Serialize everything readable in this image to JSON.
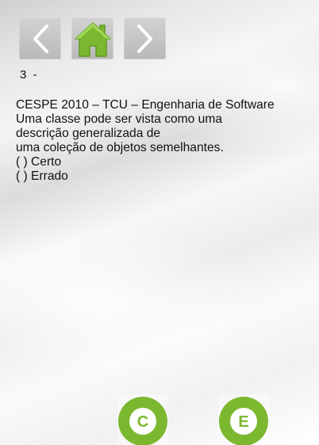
{
  "nav": {
    "previous_icon": "chevron-left-icon",
    "home_icon": "home-icon",
    "next_icon": "chevron-right-icon",
    "accent_color": "#7cb82f",
    "button_color": "#c4c4c4"
  },
  "counter": "3  -",
  "question": {
    "lines": [
      "CESPE 2010 – TCU – Engenharia de Software",
      "Uma classe pode ser vista como uma",
      "descrição generalizada de",
      "uma coleção de objetos semelhantes.",
      "( ) Certo",
      "( ) Errado"
    ]
  },
  "answers": {
    "certo_letter": "C",
    "errado_letter": "E",
    "color": "#7cb82f"
  }
}
